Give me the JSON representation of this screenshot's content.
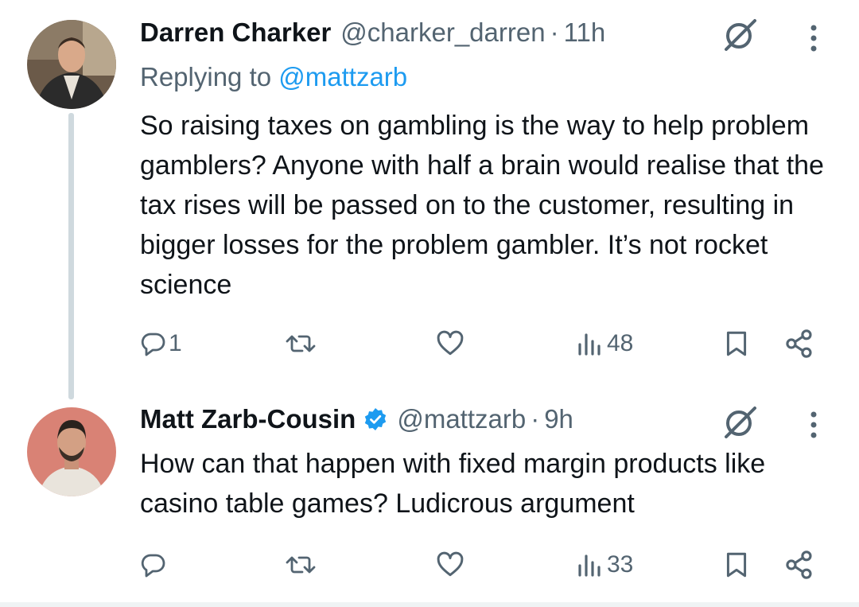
{
  "tweets": [
    {
      "author_name": "Darren Charker",
      "handle": "@charker_darren",
      "separator": "·",
      "time": "11h",
      "replying_prefix": "Replying to ",
      "replying_mention": "@mattzarb",
      "text": "So raising taxes on gambling is the way to help problem gamblers? Anyone with half a brain would realise that the tax rises will be passed on to the customer, resulting in bigger losses for the problem gambler. It’s not rocket science",
      "reply_count": "1",
      "views": "48",
      "verified": false
    },
    {
      "author_name": "Matt Zarb-Cousin",
      "handle": "@mattzarb",
      "separator": "·",
      "time": "9h",
      "text": "How can that happen with fixed margin products like casino table games? Ludicrous argument",
      "reply_count": "",
      "views": "33",
      "verified": true
    }
  ],
  "colors": {
    "text_primary": "#0f1419",
    "text_secondary": "#536471",
    "accent": "#1d9bf0",
    "thread_line": "#cfd9de"
  },
  "icons": [
    "grok-icon",
    "more-vertical-icon",
    "reply-icon",
    "retweet-icon",
    "like-icon",
    "views-icon",
    "bookmark-icon",
    "share-icon",
    "verified-badge-icon"
  ]
}
